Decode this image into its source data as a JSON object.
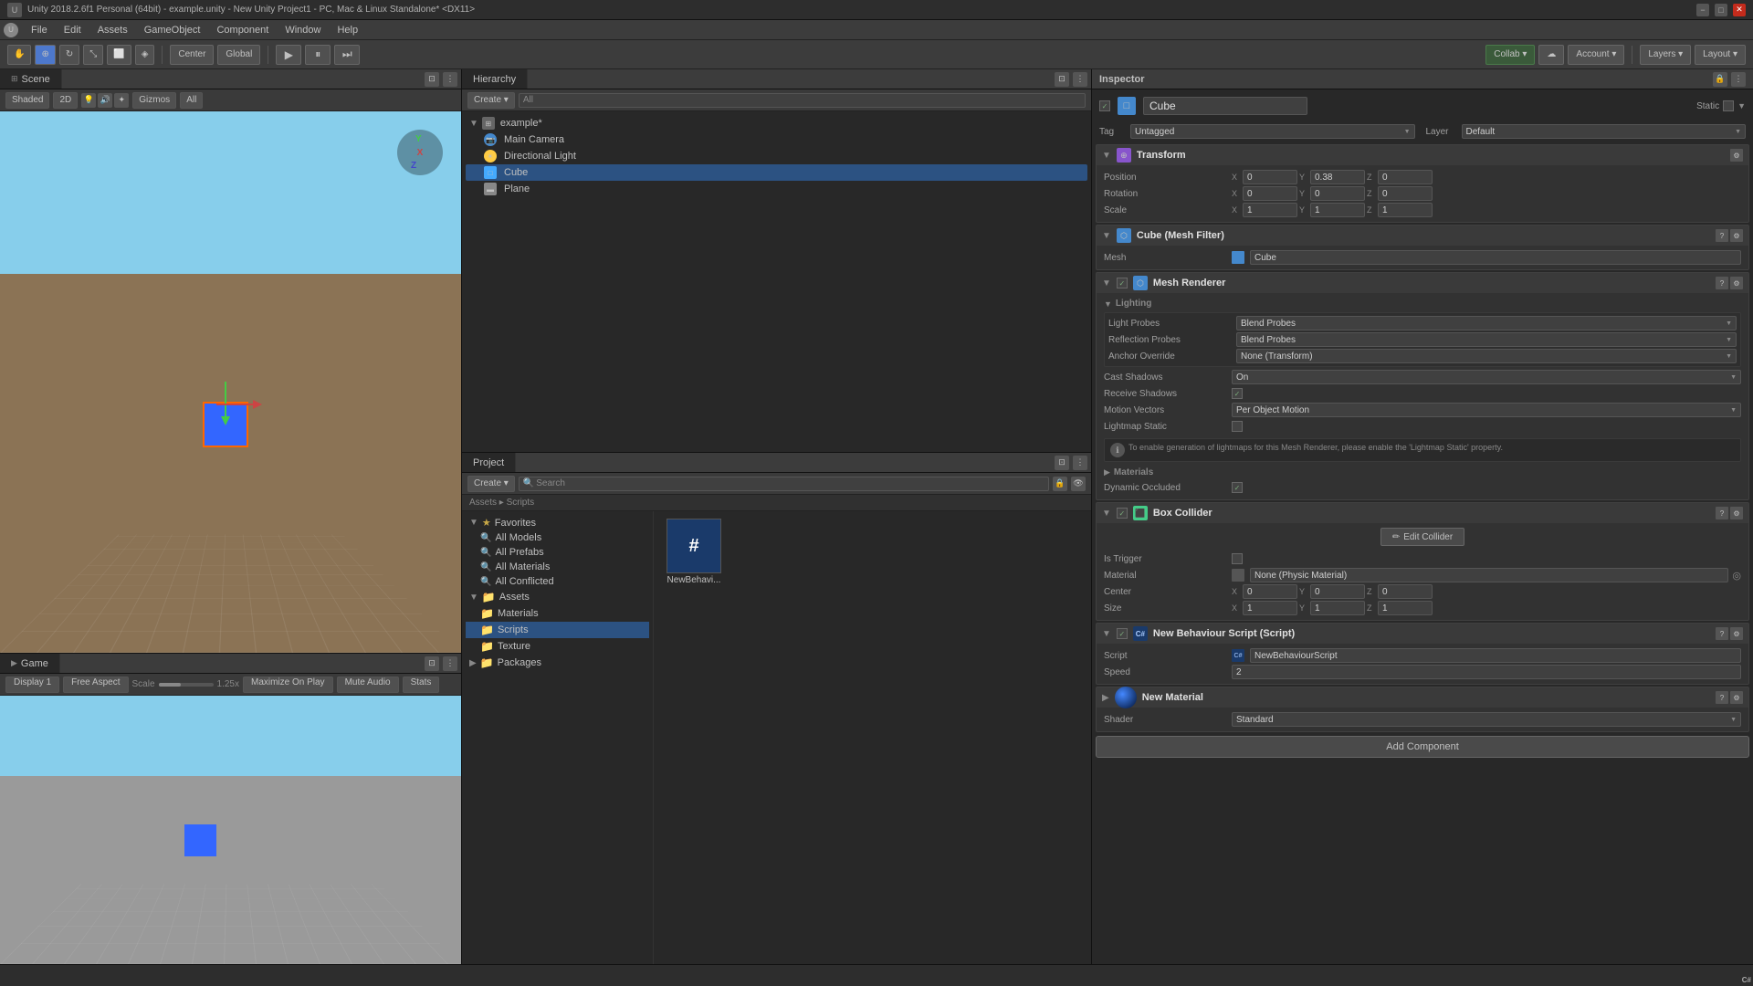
{
  "titlebar": {
    "title": "Unity 2018.2.6f1 Personal (64bit) - example.unity - New Unity Project1 - PC, Mac & Linux Standalone* <DX11>",
    "min_label": "−",
    "max_label": "□",
    "close_label": "✕"
  },
  "menubar": {
    "items": [
      "File",
      "Edit",
      "Assets",
      "GameObject",
      "Component",
      "Window",
      "Help"
    ]
  },
  "toolbar": {
    "hand_tool": "✋",
    "move_tool": "⊕",
    "rotate_tool": "↻",
    "scale_tool": "⤡",
    "rect_tool": "⬜",
    "transform_tool": "◈",
    "center_label": "Center",
    "global_label": "Global",
    "play_btn": "▶",
    "pause_btn": "⏸",
    "step_btn": "⏭",
    "collab_label": "Collab ▾",
    "cloud_label": "☁",
    "account_label": "Account ▾",
    "layers_label": "Layers ▾",
    "layout_label": "Layout ▾"
  },
  "scene_panel": {
    "title": "Scene",
    "shaded_label": "Shaded",
    "two_d_label": "2D",
    "gizmos_label": "Gizmos",
    "all_label": "All",
    "watermark": "≡ Shaded"
  },
  "game_panel": {
    "title": "Game",
    "display_label": "Display 1",
    "aspect_label": "Free Aspect",
    "scale_label": "Scale",
    "scale_value": "1.25x",
    "maximize_label": "Maximize On Play",
    "mute_label": "Mute Audio",
    "stats_label": "Stats"
  },
  "hierarchy_panel": {
    "title": "Hierarchy",
    "create_label": "Create ▾",
    "all_label": "All",
    "items": [
      {
        "name": "example*",
        "type": "scene",
        "expanded": true,
        "indent": 0
      },
      {
        "name": "Main Camera",
        "type": "camera",
        "indent": 1
      },
      {
        "name": "Directional Light",
        "type": "light",
        "indent": 1
      },
      {
        "name": "Cube",
        "type": "cube",
        "indent": 1,
        "selected": true
      },
      {
        "name": "Plane",
        "type": "plane",
        "indent": 1
      }
    ]
  },
  "project_panel": {
    "title": "Project",
    "create_label": "Create ▾",
    "search_placeholder": "Search",
    "breadcrumb": "Assets ▸ Scripts",
    "favorites": {
      "label": "Favorites",
      "items": [
        "All Models",
        "All Prefabs",
        "All Materials",
        "All Conflicted"
      ]
    },
    "assets": {
      "label": "Assets",
      "items": [
        "Materials",
        "Scripts",
        "Texture"
      ]
    },
    "packages": {
      "label": "Packages"
    },
    "files": [
      {
        "name": "NewBehavi...",
        "type": "cs"
      }
    ]
  },
  "inspector_panel": {
    "title": "Inspector",
    "object_name": "Cube",
    "object_icon": "□",
    "static_label": "Static",
    "tag_label": "Tag",
    "tag_value": "Untagged",
    "layer_label": "Layer",
    "layer_value": "Default",
    "transform": {
      "title": "Transform",
      "position_label": "Position",
      "position": {
        "x": "0",
        "y": "0.38",
        "z": "0"
      },
      "rotation_label": "Rotation",
      "rotation": {
        "x": "0",
        "y": "0",
        "z": "0"
      },
      "scale_label": "Scale",
      "scale": {
        "x": "1",
        "y": "1",
        "z": "1"
      }
    },
    "mesh_filter": {
      "title": "Cube (Mesh Filter)",
      "mesh_label": "Mesh",
      "mesh_value": "Cube"
    },
    "mesh_renderer": {
      "title": "Mesh Renderer",
      "lighting_label": "Lighting",
      "light_probes_label": "Light Probes",
      "light_probes_value": "Blend Probes",
      "reflection_probes_label": "Reflection Probes",
      "reflection_probes_value": "Blend Probes",
      "anchor_override_label": "Anchor Override",
      "anchor_override_value": "None (Transform)",
      "cast_shadows_label": "Cast Shadows",
      "cast_shadows_value": "On",
      "receive_shadows_label": "Receive Shadows",
      "motion_vectors_label": "Motion Vectors",
      "motion_vectors_value": "Per Object Motion",
      "lightmap_static_label": "Lightmap Static",
      "info_text": "To enable generation of lightmaps for this Mesh Renderer, please enable the 'Lightmap Static' property.",
      "materials_label": "Materials",
      "dynamic_occluded_label": "Dynamic Occluded"
    },
    "box_collider": {
      "title": "Box Collider",
      "edit_collider_label": "Edit Collider",
      "is_trigger_label": "Is Trigger",
      "material_label": "Material",
      "material_value": "None (Physic Material)",
      "center_label": "Center",
      "center": {
        "x": "0",
        "y": "0",
        "z": "0"
      },
      "size_label": "Size",
      "size": {
        "x": "1",
        "y": "1",
        "z": "1"
      }
    },
    "new_behaviour": {
      "title": "New Behaviour Script (Script)",
      "script_label": "Script",
      "script_value": "NewBehaviourScript",
      "speed_label": "Speed",
      "speed_value": "2"
    },
    "new_material": {
      "title": "New Material",
      "shader_label": "Shader",
      "shader_value": "Standard"
    },
    "add_component_label": "Add Component"
  },
  "statusbar": {
    "message": ""
  }
}
